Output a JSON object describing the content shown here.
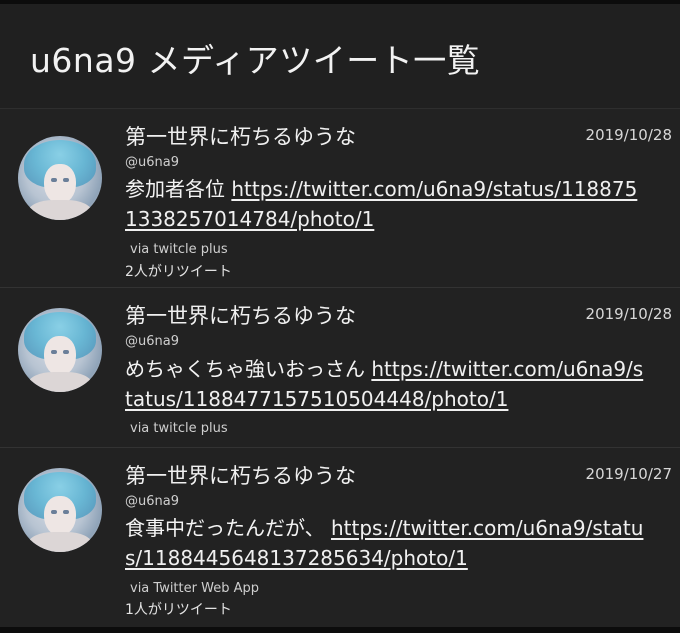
{
  "header": {
    "title": "u6na9 メディアツイート一覧"
  },
  "tweets": [
    {
      "name": "第一世界に朽ちるゆうな",
      "handle": "@u6na9",
      "date": "2019/10/28",
      "text": "参加者各位 ",
      "link": "https://twitter.com/u6na9/status/1188751338257014784/photo/1",
      "via": "via twitcle plus",
      "retweets": "2人がリツイート"
    },
    {
      "name": "第一世界に朽ちるゆうな",
      "handle": "@u6na9",
      "date": "2019/10/28",
      "text": "めちゃくちゃ強いおっさん ",
      "link": "https://twitter.com/u6na9/status/1188477157510504448/photo/1",
      "via": "via twitcle plus",
      "retweets": ""
    },
    {
      "name": "第一世界に朽ちるゆうな",
      "handle": "@u6na9",
      "date": "2019/10/27",
      "text": "食事中だったんだが、 ",
      "link": "https://twitter.com/u6na9/status/1188445648137285634/photo/1",
      "via": "via Twitter Web App",
      "retweets": "1人がリツイート"
    }
  ]
}
